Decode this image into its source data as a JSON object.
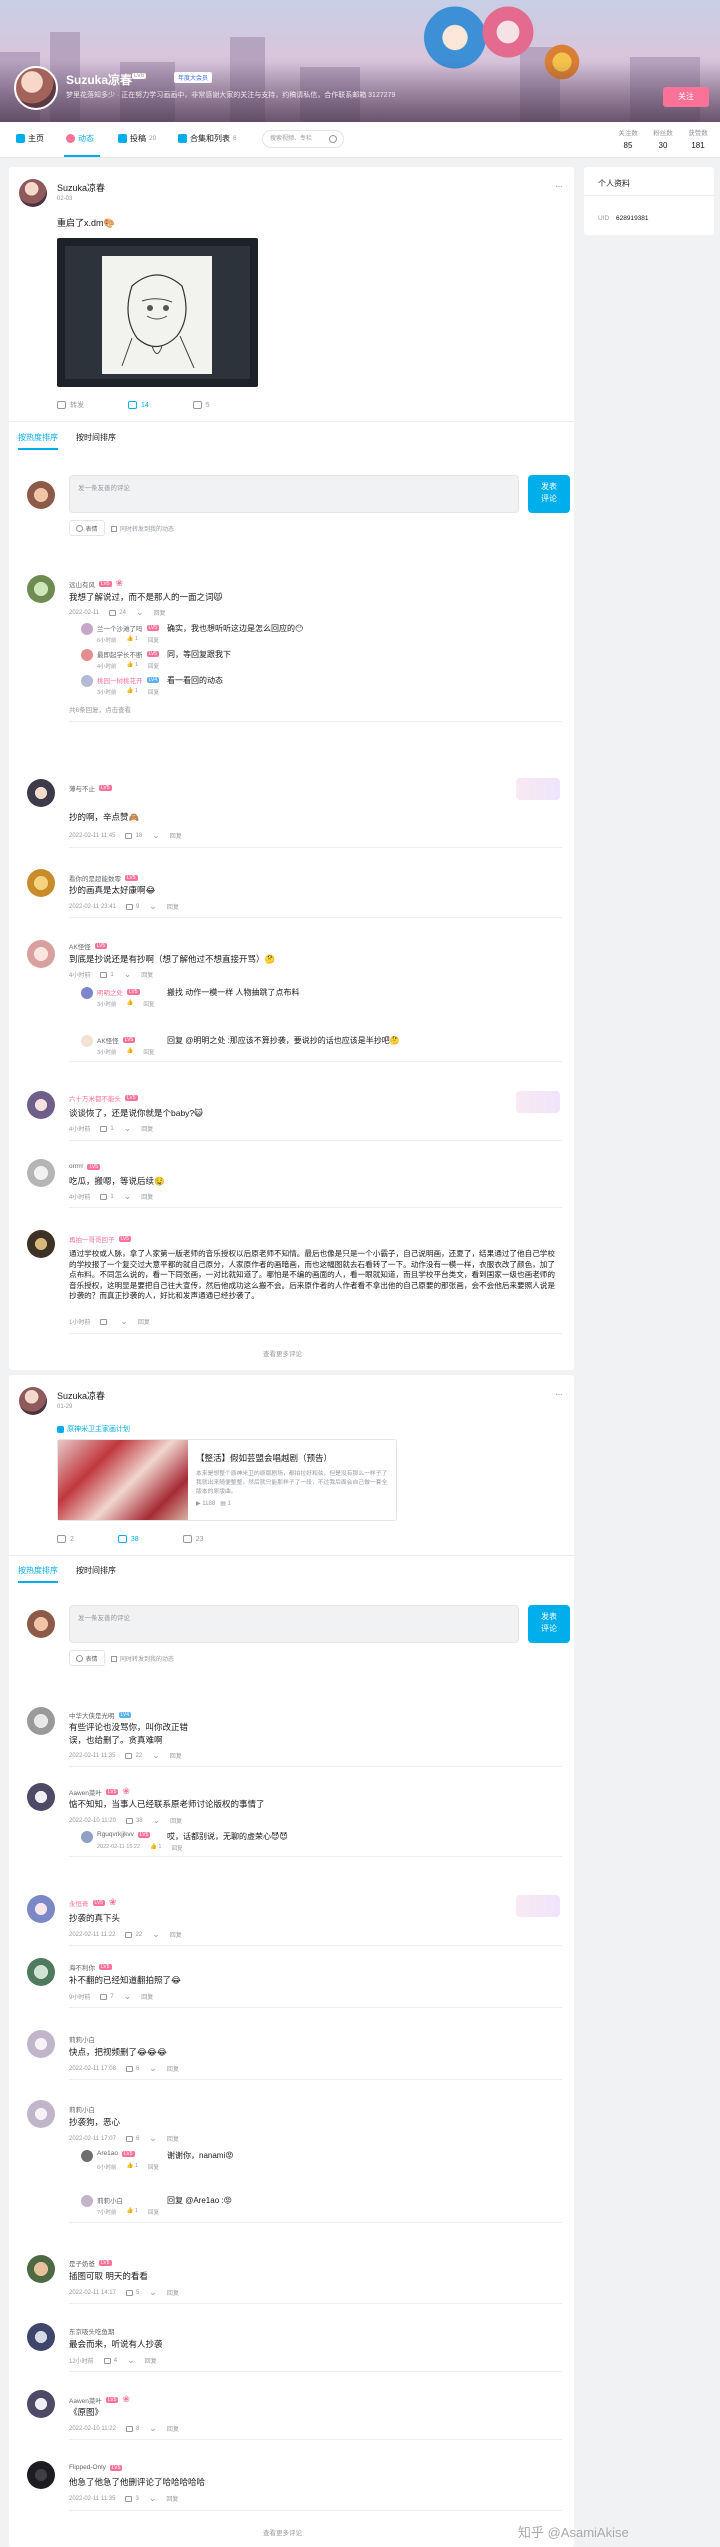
{
  "header": {
    "username": "Suzuka凉春",
    "level": "LV6",
    "vip": "年度大会员",
    "signature": "梦里花落知多少 · 正在努力学习画画中，非常感谢大家的关注与支持，约稿请私信，合作联系邮箱 3127279",
    "follow": "关注"
  },
  "nav": {
    "tabs": [
      {
        "label": "主页",
        "count": ""
      },
      {
        "label": "动态",
        "count": ""
      },
      {
        "label": "投稿",
        "count": "20"
      },
      {
        "label": "合集和列表",
        "count": "6"
      }
    ],
    "search_placeholder": "搜索视频、专栏"
  },
  "stats": [
    {
      "label": "关注数",
      "value": "85"
    },
    {
      "label": "粉丝数",
      "value": "30"
    },
    {
      "label": "获赞数",
      "value": "181"
    }
  ],
  "sidebar": {
    "title": "个人资料",
    "uid_label": "UID",
    "uid": "628919381"
  },
  "post1": {
    "author": "Suzuka凉春",
    "time": "02-03",
    "text": "重启了x.dm🎨",
    "forward": "转发",
    "comments": "14",
    "likes": "5"
  },
  "sort": {
    "hot": "按热度排序",
    "new": "按时间排序"
  },
  "composer": {
    "placeholder": "发一条友善的评论",
    "button": "发表\n评论",
    "emoji": "表情",
    "check": "同时转发到我的动态"
  },
  "thread1": [
    {
      "name": "远山有风",
      "text": "我想了解说过，而不是那人的一面之词😾",
      "time": "2022-02-11",
      "likes": "24",
      "reply": "回复",
      "replies": [
        {
          "name": "兰一个沙滩了吗",
          "text": "确实，我也想听听这边是怎么回应的😶",
          "time": "6小时前",
          "likes": "1"
        },
        {
          "name": "最即起学长不断",
          "text": "同，等回复跟我下",
          "time": "4小时前",
          "likes": "1"
        },
        {
          "name": "桃园一树桃花开",
          "text": "看一看回的动态",
          "time": "3小时前",
          "likes": "1"
        }
      ],
      "footer": "共6条回复，点击查看"
    },
    {
      "name": "薄与不止",
      "text": "抄的啊，辛点赞🙈",
      "time": "2022-02-11 11:45",
      "likes": "18",
      "reply": "回复"
    },
    {
      "name": "看你的是超能数零",
      "text": "抄的画真是太好康啊😂",
      "time": "2022-02-11 23:41",
      "likes": "9",
      "reply": "回复"
    },
    {
      "name": "AK怪怪",
      "text": "到底是抄说还是有抄啊（想了解他过不想直接开骂）🤔",
      "time": "4小时前",
      "likes": "1",
      "reply": "回复",
      "replies": [
        {
          "name": "明明之处",
          "text": "搬找 动作一模一样 人物抽跳了点布料",
          "time": "3小时前",
          "likes": ""
        },
        {
          "name": "AK怪怪",
          "text": "回复 @明明之处 :那应该不算抄袭，要说抄的话也应该是半抄吧🤔",
          "time": "3小时前",
          "likes": ""
        }
      ]
    },
    {
      "name": "六十万米都不能头",
      "text": "谈谈恢了，还是说你就是个baby?😺",
      "time": "4小时前",
      "likes": "1",
      "reply": "回复"
    },
    {
      "name": "orrrrr",
      "text": "吃瓜，搬嗯，等说后续🤤",
      "time": "4小时前",
      "likes": "1",
      "reply": "回复"
    },
    {
      "name": "再拍一哥哥回子",
      "text": "通过学校或人脉，拿了人家第一版老师的音乐授权以后原老师不知情。最后也像是只是一个小霸子，自己说明画，还夏了，结果通过了他自己学校的学校报了一个复交过大意平都的就自己原分，人家原作者的画暗画，而也这幅图就去石看转了一下。动作没有一模一样，衣服衣改了颜色，加了点布料。不同怎么说的，看一下同张画，一对比就知道了。哪怕是不编的画面的人，看一眼就知道，而且学校平台类文，看到国家一级也画老师的音乐授权，这明显是要把自己往大宣传，然后他成功这么搬不会。后来原作者的人作者看不拿出他的自己原要的那张画，会不会他后来要照人说是抄袭的？而真正抄袭的人，好比和发声通通已经抄袭了。",
      "time": "1小时前",
      "likes": "",
      "reply": "回复"
    }
  ],
  "more1": "查看更多评论",
  "post2": {
    "author": "Suzuka凉春",
    "time": "01-29",
    "tag": "原神米卫主家画计划",
    "card_title": "【整活】假如芸盟会唱越剧（预告）",
    "card_desc": "本来是想整个原神米卫的原版剧场，都拍拉好和弦，但是没有那么一样子了我就出来随便整整，然后就只能那样子了一段，不过我后面会自己做一套全版本的原版曲。",
    "card_plays": "1188",
    "card_danmaku": "1",
    "forward": "2",
    "comments": "38",
    "likes": "23"
  },
  "thread2": [
    {
      "name": "中华大侠是光明",
      "text": "有些评论也没骂你，叫你改正错误，也给删了。贪真难啊",
      "time": "2022-02-11 11:35",
      "likes": "22",
      "reply": "回复"
    },
    {
      "name": "Aawen菜叶",
      "text": "惦不知知，当事人已经联系原老师讨论版权的事情了",
      "time": "2022-02-10 11:20",
      "likes": "38",
      "reply": "回复",
      "replies": [
        {
          "name": "Rguqvrkjjkvv",
          "text": "哎，话都别说，无聊的虚荣心😈😈",
          "time": "2022-02-11 15:22",
          "likes": "1"
        }
      ]
    },
    {
      "name": "永恒奇",
      "text": "抄袭的真下头",
      "time": "2022-02-11 11:22",
      "likes": "22",
      "reply": "回复"
    },
    {
      "name": "海不利你",
      "text": "补不翻的已经知道翻拍照了😂",
      "time": "9小时前",
      "likes": "7",
      "reply": "回复"
    },
    {
      "name": "莉莉小白",
      "text": "快点，把视频删了😂😂😂",
      "time": "2022-02-11 17:08",
      "likes": "6",
      "reply": "回复"
    },
    {
      "name": "莉莉小白",
      "text": "抄袭狗，恶心",
      "time": "2022-02-11 17:07",
      "likes": "6",
      "reply": "回复",
      "replies": [
        {
          "name": "Are1ao",
          "text": "谢谢你，nanami😡",
          "time": "6小时前",
          "likes": "1"
        },
        {
          "name": "莉莉小白",
          "text": "回复 @Are1ao :😡",
          "time": "7小时前",
          "likes": "1"
        }
      ]
    },
    {
      "name": "是子奶爸",
      "text": "插图可取 明天的看看",
      "time": "2022-02-11 14:17",
      "likes": "5",
      "reply": "回复"
    },
    {
      "name": "东京吸头吃鱼期",
      "text": "最会而来，听说有人抄袭",
      "time": "12小时前",
      "likes": "4",
      "reply": "回复"
    },
    {
      "name": "Aawen菜叶",
      "text": "《原图》",
      "time": "2022-02-10 11:22",
      "likes": "8",
      "reply": "回复"
    },
    {
      "name": "Flipped-Only",
      "text": "他急了他急了他删评论了哈哈哈哈哈",
      "time": "2022-02-11 11:35",
      "likes": "3",
      "reply": "回复"
    }
  ],
  "more2": "查看更多评论",
  "watermark": "知乎 @AsamiAkise"
}
